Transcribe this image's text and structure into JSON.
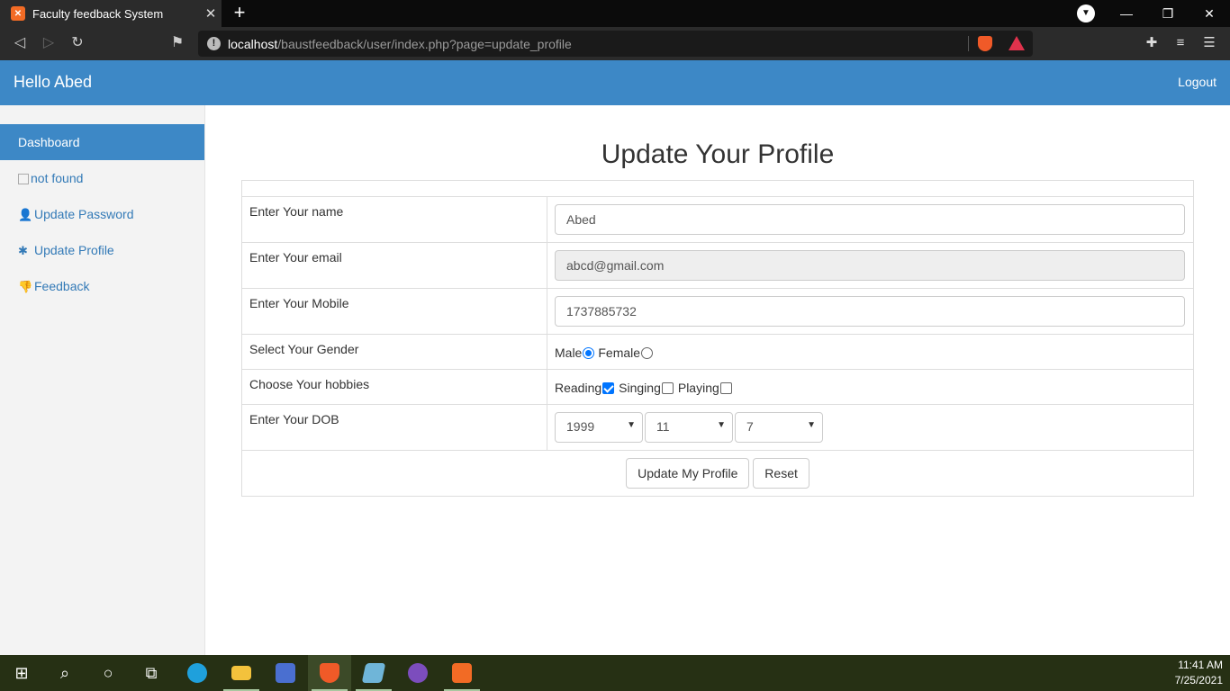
{
  "browser": {
    "tab_title": "Faculty feedback System",
    "url_host": "localhost",
    "url_path": "/baustfeedback/user/index.php?page=update_profile"
  },
  "header": {
    "brand": "Hello Abed",
    "logout": "Logout"
  },
  "sidebar": {
    "items": [
      {
        "label": "Dashboard",
        "icon": ""
      },
      {
        "label": "not found",
        "icon": ""
      },
      {
        "label": "Update Password",
        "icon": "👤"
      },
      {
        "label": "Update Profile",
        "icon": "✱"
      },
      {
        "label": "Feedback",
        "icon": "👎"
      }
    ]
  },
  "form": {
    "title": "Update Your Profile",
    "name_label": "Enter Your name",
    "name_value": "Abed",
    "email_label": "Enter Your email",
    "email_value": "abcd@gmail.com",
    "mobile_label": "Enter Your Mobile",
    "mobile_value": "1737885732",
    "gender_label": "Select Your Gender",
    "gender_options": [
      "Male",
      "Female"
    ],
    "gender_selected": "Male",
    "hobbies_label": "Choose Your hobbies",
    "hobbies": [
      {
        "label": "Reading",
        "checked": true
      },
      {
        "label": "Singing",
        "checked": false
      },
      {
        "label": "Playing",
        "checked": false
      }
    ],
    "dob_label": "Enter Your DOB",
    "dob_year": "1999",
    "dob_month": "11",
    "dob_day": "7",
    "submit_label": "Update My Profile",
    "reset_label": "Reset"
  },
  "taskbar": {
    "time": "11:41 AM",
    "date": "7/25/2021"
  },
  "colors": {
    "accent": "#3d88c6",
    "link": "#337ab7"
  }
}
